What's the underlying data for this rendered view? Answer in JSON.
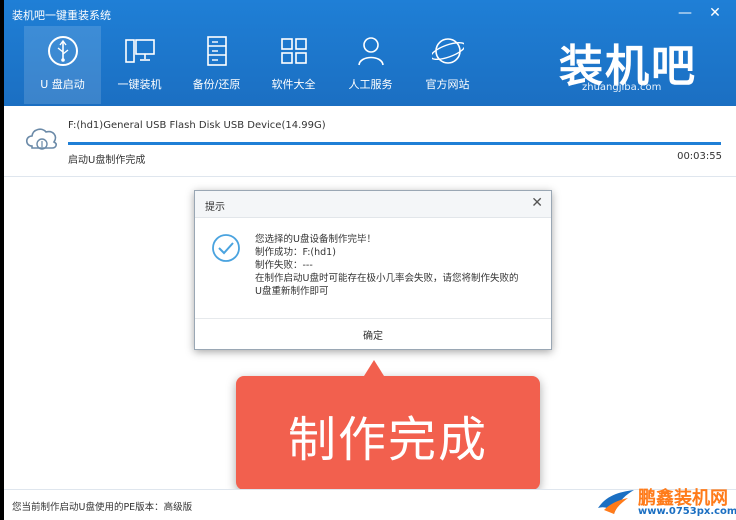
{
  "window": {
    "title": "装机吧一键重装系统",
    "minimize": "—",
    "close": "✕"
  },
  "nav": {
    "items": [
      {
        "label": "U 盘启动",
        "icon": "usb-icon",
        "active": true
      },
      {
        "label": "一键装机",
        "icon": "computer-icon"
      },
      {
        "label": "备份/还原",
        "icon": "server-icon"
      },
      {
        "label": "软件大全",
        "icon": "grid-icon"
      },
      {
        "label": "人工服务",
        "icon": "user-icon"
      },
      {
        "label": "官方网站",
        "icon": "globe-icon"
      }
    ]
  },
  "brand": {
    "logo_text": "装机吧",
    "url": "zhuangjiba.com"
  },
  "device": {
    "name": "F:(hd1)General USB Flash Disk USB Device(14.99G)",
    "status": "启动U盘制作完成",
    "elapsed": "00:03:55",
    "progress": 1.0
  },
  "dialog": {
    "title": "提示",
    "close": "✕",
    "lines": [
      "您选择的U盘设备制作完毕！",
      "制作成功：F:(hd1)",
      "制作失败：---",
      "在制作启动U盘时可能存在极小几率会失败，请您将制作失败的",
      "U盘重新制作即可"
    ],
    "ok_label": "确定"
  },
  "callout": {
    "text": "制作完成"
  },
  "footer": {
    "text": "您当前制作启动U盘使用的PE版本：高级版"
  },
  "watermark": {
    "title": "鹏鑫装机网",
    "url": "www.0753px.com"
  },
  "colors": {
    "header_blue": "#1b6fc2",
    "progress_blue": "#1f7fd6",
    "callout_red": "#f2604e",
    "check_blue": "#4aa3df"
  }
}
